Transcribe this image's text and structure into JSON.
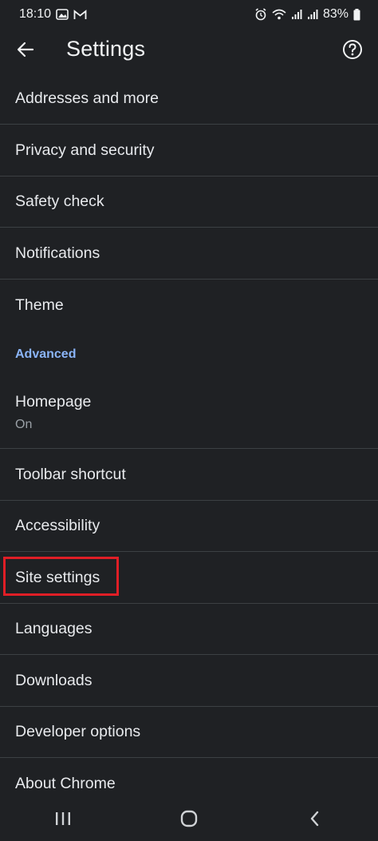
{
  "status": {
    "time": "18:10",
    "battery": "83%"
  },
  "app_bar": {
    "title": "Settings"
  },
  "items_top": [
    {
      "label": "Addresses and more"
    },
    {
      "label": "Privacy and security"
    },
    {
      "label": "Safety check"
    },
    {
      "label": "Notifications"
    },
    {
      "label": "Theme"
    }
  ],
  "section": {
    "advanced": "Advanced"
  },
  "items_advanced": [
    {
      "label": "Homepage",
      "sub": "On"
    },
    {
      "label": "Toolbar shortcut"
    },
    {
      "label": "Accessibility"
    },
    {
      "label": "Site settings",
      "highlighted": true
    },
    {
      "label": "Languages"
    },
    {
      "label": "Downloads"
    },
    {
      "label": "Developer options"
    },
    {
      "label": "About Chrome"
    }
  ],
  "colors": {
    "background": "#1f2124",
    "accent": "#8ab4f8",
    "highlight_box": "#e01e26",
    "divider": "#3c4043"
  },
  "icons": {
    "back": "arrow-left-icon",
    "help": "help-circle-icon",
    "nav_recents": "recents-icon",
    "nav_home": "home-icon",
    "nav_back": "chevron-left-icon"
  }
}
